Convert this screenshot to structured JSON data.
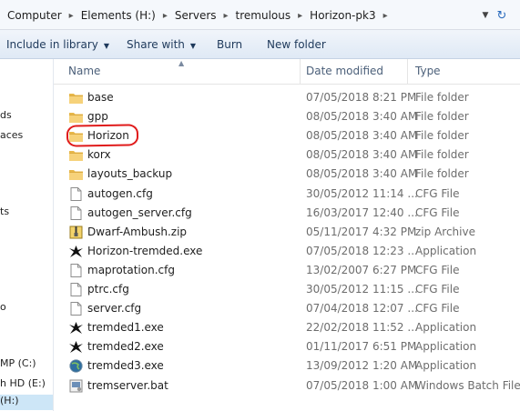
{
  "breadcrumb": [
    "Computer",
    "Elements (H:)",
    "Servers",
    "tremulous",
    "Horizon-pk3"
  ],
  "toolbar": {
    "include": "Include in library",
    "share": "Share with",
    "burn": "Burn",
    "new_folder": "New folder"
  },
  "nav_fragments": [
    "ds",
    "aces",
    "ts",
    "o",
    "MP (C:)",
    "h HD (E:)",
    "(H:)"
  ],
  "columns": {
    "name": "Name",
    "date": "Date modified",
    "type": "Type"
  },
  "files": [
    {
      "name": "base",
      "date": "07/05/2018 8:21 PM",
      "type": "File folder",
      "icon": "folder-icon"
    },
    {
      "name": "gpp",
      "date": "08/05/2018 3:40 AM",
      "type": "File folder",
      "icon": "folder-icon"
    },
    {
      "name": "Horizon",
      "date": "08/05/2018 3:40 AM",
      "type": "File folder",
      "icon": "folder-icon"
    },
    {
      "name": "korx",
      "date": "08/05/2018 3:40 AM",
      "type": "File folder",
      "icon": "folder-icon"
    },
    {
      "name": "layouts_backup",
      "date": "08/05/2018 3:40 AM",
      "type": "File folder",
      "icon": "folder-icon"
    },
    {
      "name": "autogen.cfg",
      "date": "30/05/2012 11:14 ...",
      "type": "CFG File",
      "icon": "file-icon"
    },
    {
      "name": "autogen_server.cfg",
      "date": "16/03/2017 12:40 ...",
      "type": "CFG File",
      "icon": "file-icon"
    },
    {
      "name": "Dwarf-Ambush.zip",
      "date": "05/11/2017 4:32 PM",
      "type": "zip Archive",
      "icon": "zip-icon"
    },
    {
      "name": "Horizon-tremded.exe",
      "date": "07/05/2018 12:23 ...",
      "type": "Application",
      "icon": "alien-app-icon"
    },
    {
      "name": "maprotation.cfg",
      "date": "13/02/2007 6:27 PM",
      "type": "CFG File",
      "icon": "file-icon"
    },
    {
      "name": "ptrc.cfg",
      "date": "30/05/2012 11:15 ...",
      "type": "CFG File",
      "icon": "file-icon"
    },
    {
      "name": "server.cfg",
      "date": "07/04/2018 12:07 ...",
      "type": "CFG File",
      "icon": "file-icon"
    },
    {
      "name": "tremded1.exe",
      "date": "22/02/2018 11:52 ...",
      "type": "Application",
      "icon": "alien-app-icon"
    },
    {
      "name": "tremded2.exe",
      "date": "01/11/2017 6:51 PM",
      "type": "Application",
      "icon": "alien-app-icon"
    },
    {
      "name": "tremded3.exe",
      "date": "13/09/2012 1:20 AM",
      "type": "Application",
      "icon": "globe-app-icon"
    },
    {
      "name": "tremserver.bat",
      "date": "07/05/2018 1:00 AM",
      "type": "Windows Batch File",
      "icon": "batch-icon"
    }
  ]
}
